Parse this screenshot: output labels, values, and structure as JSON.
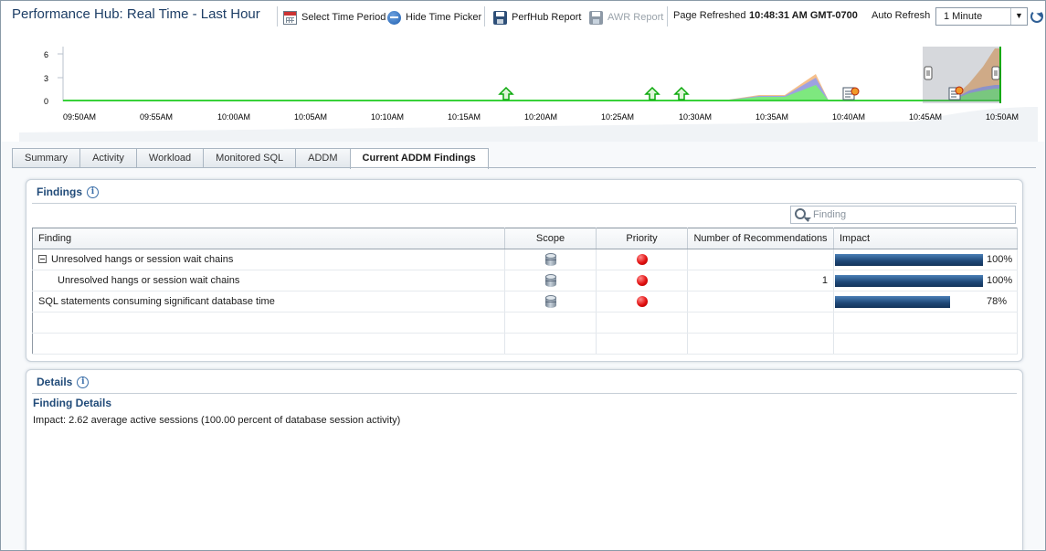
{
  "header": {
    "title": "Performance Hub: Real Time - Last Hour",
    "select_time_period": "Select Time Period",
    "hide_time_picker": "Hide Time Picker",
    "perfhub_report": "PerfHub Report",
    "awr_report": "AWR Report",
    "page_refreshed_label": "Page Refreshed",
    "page_refreshed_value": "10:48:31 AM GMT-0700",
    "auto_refresh_label": "Auto Refresh",
    "auto_refresh_value": "1 Minute",
    "icons": [
      "calendar-icon",
      "minus-circle-icon",
      "save-icon",
      "save-icon",
      "refresh-icon"
    ]
  },
  "timeline": {
    "y_ticks": [
      "6",
      "3",
      "0"
    ],
    "x_ticks": [
      "09:50AM",
      "09:55AM",
      "10:00AM",
      "10:05AM",
      "10:10AM",
      "10:15AM",
      "10:20AM",
      "10:25AM",
      "10:30AM",
      "10:35AM",
      "10:40AM",
      "10:45AM",
      "10:50AM"
    ],
    "colors": {
      "baseline": "#38d13a",
      "green_area": "#7ee87f",
      "blue_area": "#8e9bf0",
      "orange_area": "#f3b476",
      "selection": "#6b7480",
      "marker": "#0aa90a"
    },
    "markers": [
      {
        "type": "upload-arrow-icon",
        "time": "10:17AM"
      },
      {
        "type": "upload-arrow-icon",
        "time": "10:27AM"
      },
      {
        "type": "upload-arrow-icon",
        "time": "10:29AM"
      },
      {
        "type": "report-icon",
        "time": "10:40AM"
      },
      {
        "type": "report-icon",
        "time": "10:47AM"
      }
    ]
  },
  "tabs": [
    {
      "label": "Summary",
      "active": false
    },
    {
      "label": "Activity",
      "active": false
    },
    {
      "label": "Workload",
      "active": false
    },
    {
      "label": "Monitored SQL",
      "active": false
    },
    {
      "label": "ADDM",
      "active": false
    },
    {
      "label": "Current ADDM Findings",
      "active": true
    }
  ],
  "findings": {
    "title": "Findings",
    "search_placeholder": "Finding",
    "columns": [
      "Finding",
      "Scope",
      "Priority",
      "Number of Recommendations",
      "Impact"
    ],
    "rows": [
      {
        "finding": "Unresolved hangs or session wait chains",
        "recommendations": "",
        "impact": 100,
        "impact_label": "100%"
      },
      {
        "finding": "Unresolved hangs or session wait chains",
        "recommendations": "1",
        "impact": 100,
        "impact_label": "100%"
      },
      {
        "finding": "SQL statements consuming significant database time",
        "recommendations": "",
        "impact": 78,
        "impact_label": "78%"
      }
    ]
  },
  "details": {
    "title": "Details",
    "subtitle": "Finding Details",
    "text": "Impact: 2.62 average active sessions (100.00 percent of database session activity)"
  }
}
